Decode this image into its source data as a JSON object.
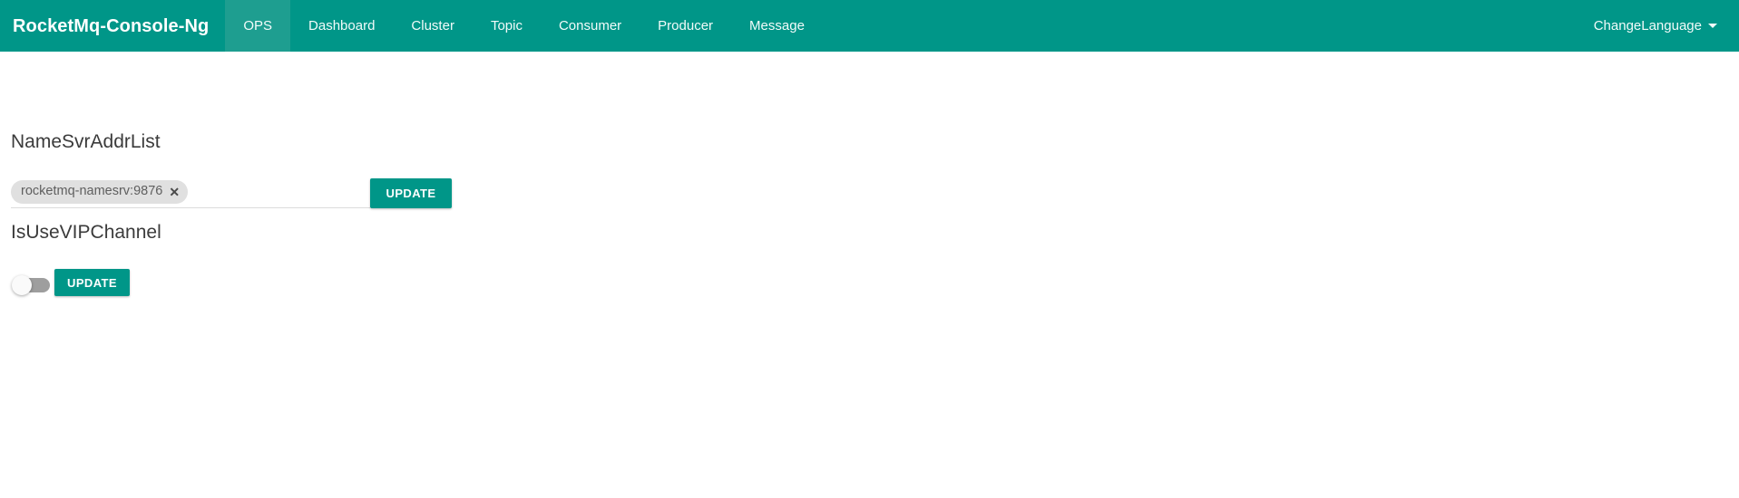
{
  "navbar": {
    "brand": "RocketMq-Console-Ng",
    "brand_color": "#ffffff",
    "background_color": "#009688",
    "active_background_color": "#1e9e90",
    "items": [
      {
        "label": "OPS",
        "active": true
      },
      {
        "label": "Dashboard",
        "active": false
      },
      {
        "label": "Cluster",
        "active": false
      },
      {
        "label": "Topic",
        "active": false
      },
      {
        "label": "Consumer",
        "active": false
      },
      {
        "label": "Producer",
        "active": false
      },
      {
        "label": "Message",
        "active": false
      }
    ],
    "language": {
      "label": "ChangeLanguage",
      "caret_icon": "chevron-down-icon"
    }
  },
  "main": {
    "namesvr": {
      "title": "NameSvrAddrList",
      "chips": [
        {
          "label": "rocketmq-namesrv:9876",
          "remove_icon": "close-icon",
          "remove_glyph": "✕"
        }
      ],
      "input_placeholder": "",
      "update_label": "UPDATE"
    },
    "vip": {
      "title": "IsUseVIPChannel",
      "toggle": {
        "name": "vip-channel-toggle",
        "state": "off"
      },
      "update_label": "UPDATE"
    }
  },
  "theme": {
    "accent": "#009688",
    "accent_active": "#1e9e90",
    "chip_background": "#e0e0e0",
    "chip_text": "#5f5f5f",
    "heading_text": "#3b3b3b",
    "underline": "#dcdcdc",
    "switch_track_off": "#9e9e9e",
    "switch_knob": "#fafafa"
  }
}
